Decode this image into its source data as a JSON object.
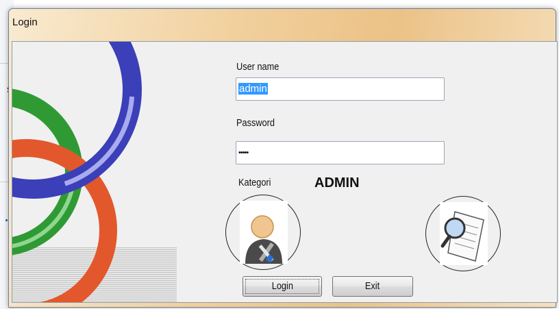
{
  "window": {
    "title": "Login"
  },
  "background": {
    "partial_text": "s"
  },
  "form": {
    "username_label": "User name",
    "username_value": "admin",
    "password_label": "Password",
    "password_value": "•••••",
    "kategori_label": "Kategori",
    "kategori_value": "ADMIN"
  },
  "icons": {
    "admin": "admin-user-tools-icon",
    "search": "magnifier-document-icon"
  },
  "buttons": {
    "login": "Login",
    "exit": "Exit"
  },
  "colors": {
    "title_bar": "#f1cf9b",
    "client_bg": "#f0f0f0",
    "selection": "#3399ff",
    "ring_blue": "#3b3fb8",
    "ring_green": "#2f9a34",
    "ring_orange": "#e2582c"
  }
}
